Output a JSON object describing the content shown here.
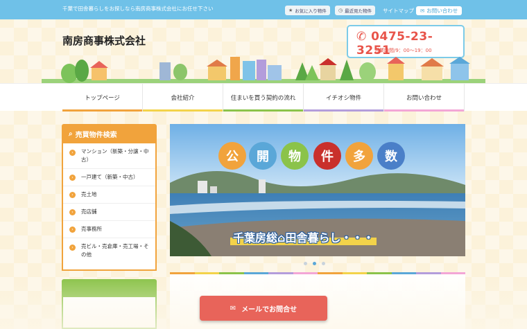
{
  "topbar": {
    "tagline": "千葉で田舎暮らしをお探しなら南房商事株式会社にお任せ下さい",
    "favorites": "お気に入り物件",
    "recent": "最近見た物件",
    "sitemap": "サイトマップ",
    "contact": "お問い合わせ"
  },
  "header": {
    "company": "南房商事株式会社",
    "phone": "0475-23-3251",
    "hours": "営業時間/9：00〜19：00"
  },
  "nav": {
    "items": [
      {
        "label": "トップページ",
        "color": "#f1a33c"
      },
      {
        "label": "会社紹介",
        "color": "#f3d34a"
      },
      {
        "label": "住まいを買う契約の流れ",
        "color": "#8bc34a"
      },
      {
        "label": "イチオシ物件",
        "color": "#b39ddb"
      },
      {
        "label": "お問い合わせ",
        "color": "#f3a6d6"
      }
    ]
  },
  "sidebar": {
    "title": "売買物件検索",
    "items": [
      "マンション（新築・分譲・中古）",
      "一戸建て（新築・中古）",
      "売土地",
      "売店舗",
      "売事務所",
      "売ビル・売倉庫・売工場・その他"
    ]
  },
  "slider": {
    "badges": [
      {
        "char": "公",
        "color": "#f1a33c"
      },
      {
        "char": "開",
        "color": "#5aa7d8"
      },
      {
        "char": "物",
        "color": "#8bc34a"
      },
      {
        "char": "件",
        "color": "#c9302c"
      },
      {
        "char": "多",
        "color": "#f1a33c"
      },
      {
        "char": "数",
        "color": "#4a7fc8"
      }
    ],
    "caption": "千葉房総",
    "caption2": "田舎暮らし・・・",
    "current_slide": 2,
    "slide_count": 3
  },
  "rainbow": [
    "#f1a33c",
    "#f3d34a",
    "#8bc34a",
    "#5aa7d8",
    "#b39ddb",
    "#f3a6d6",
    "#f1a33c",
    "#f3d34a",
    "#8bc34a",
    "#5aa7d8",
    "#b39ddb",
    "#f3a6d6"
  ],
  "mail_button": "メールでお問合せ"
}
